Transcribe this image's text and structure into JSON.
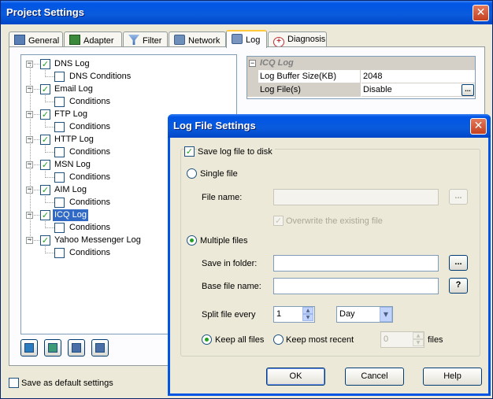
{
  "window": {
    "title": "Project Settings"
  },
  "tabs": [
    {
      "label": "General",
      "icon": "general-icon"
    },
    {
      "label": "Adapter",
      "icon": "adapter-icon"
    },
    {
      "label": "Filter",
      "icon": "filter-icon"
    },
    {
      "label": "Network",
      "icon": "network-icon"
    },
    {
      "label": "Log",
      "icon": "log-icon",
      "active": true
    },
    {
      "label": "Diagnosis",
      "icon": "diagnosis-icon"
    }
  ],
  "tree": [
    {
      "label": "DNS Log",
      "checked": true,
      "child": "DNS Conditions"
    },
    {
      "label": "Email Log",
      "checked": true,
      "child": "Conditions"
    },
    {
      "label": "FTP Log",
      "checked": true,
      "child": "Conditions"
    },
    {
      "label": "HTTP Log",
      "checked": true,
      "child": "Conditions"
    },
    {
      "label": "MSN Log",
      "checked": true,
      "child": "Conditions"
    },
    {
      "label": "AIM Log",
      "checked": true,
      "child": "Conditions"
    },
    {
      "label": "ICQ Log",
      "checked": true,
      "child": "Conditions",
      "selected": true
    },
    {
      "label": "Yahoo Messenger Log",
      "checked": true,
      "child": "Conditions"
    }
  ],
  "properties": {
    "category": "ICQ Log",
    "rows": [
      {
        "name": "Log Buffer Size(KB)",
        "value": "2048"
      },
      {
        "name": "Log File(s)",
        "value": "Disable",
        "button": "..."
      }
    ]
  },
  "default_settings_label": "Save as default settings",
  "dialog": {
    "title": "Log File Settings",
    "save_to_disk": "Save log file to disk",
    "single_file": "Single file",
    "file_name_label": "File name:",
    "file_name_value": "",
    "browse_label": "...",
    "overwrite": "Overwrite the existing file",
    "multiple_files": "Multiple files",
    "save_in_folder_label": "Save in folder:",
    "save_in_folder_value": "",
    "base_file_name_label": "Base file name:",
    "base_file_name_value": "",
    "help_btn": "?",
    "split_label": "Split file every",
    "split_value": "1",
    "split_unit": "Day",
    "keep_all": "Keep all files",
    "keep_recent": "Keep most recent",
    "keep_recent_value": "0",
    "files_label": "files",
    "ok": "OK",
    "cancel": "Cancel",
    "help": "Help"
  }
}
